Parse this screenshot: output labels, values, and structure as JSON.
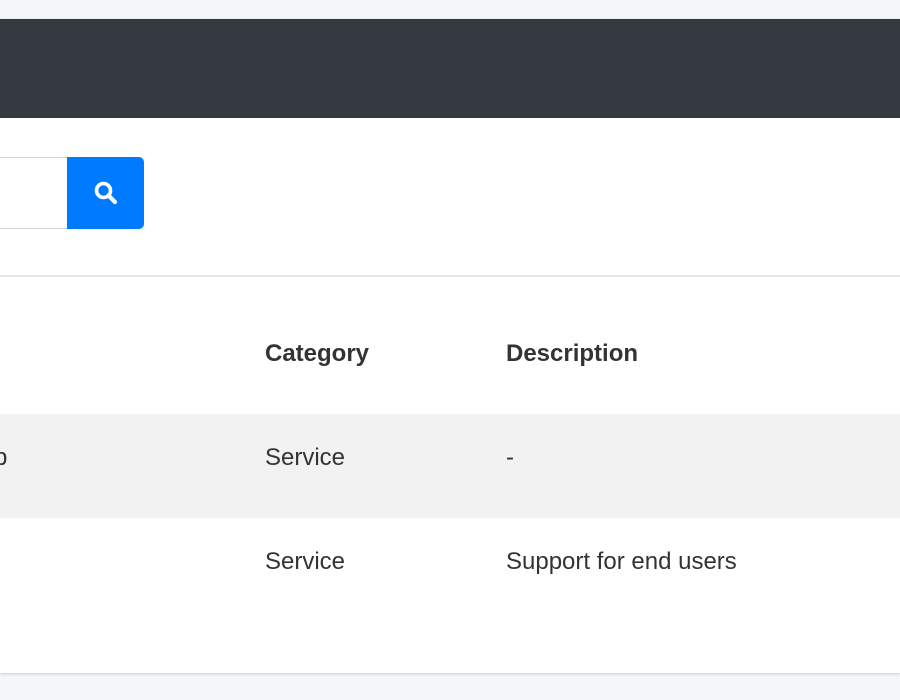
{
  "search": {
    "placeholder": "",
    "value": "",
    "button_icon": "search-icon"
  },
  "table": {
    "headers": {
      "name": "",
      "category": "Category",
      "description": "Description"
    },
    "rows": [
      {
        "name": "p",
        "category": "Service",
        "description": "-"
      },
      {
        "name": "",
        "category": "Service",
        "description": "Support for end users"
      }
    ]
  },
  "colors": {
    "header_bar": "#343a40",
    "accent": "#007bff",
    "row_stripe": "#f2f2f2"
  }
}
